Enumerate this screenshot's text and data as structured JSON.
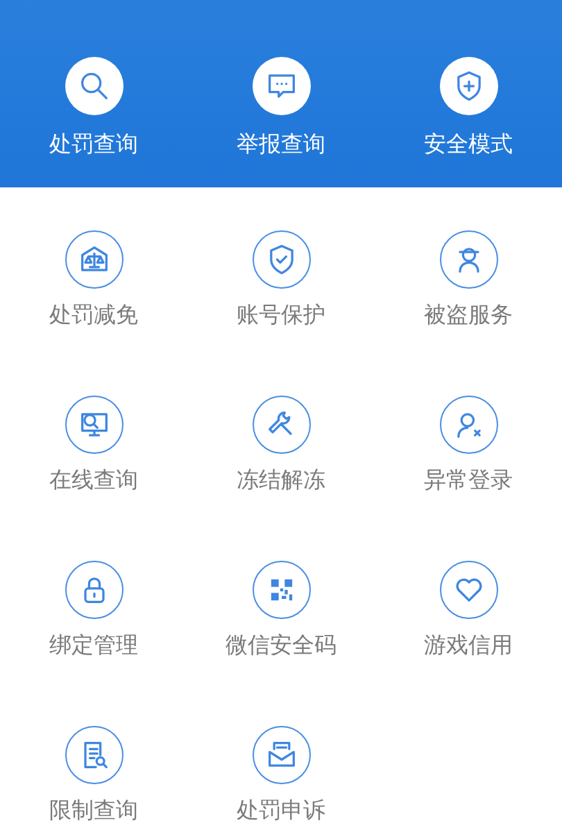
{
  "header_actions": [
    {
      "label": "处罚查询"
    },
    {
      "label": "举报查询"
    },
    {
      "label": "安全模式"
    }
  ],
  "services": [
    {
      "label": "处罚减免"
    },
    {
      "label": "账号保护"
    },
    {
      "label": "被盗服务"
    },
    {
      "label": "在线查询"
    },
    {
      "label": "冻结解冻"
    },
    {
      "label": "异常登录"
    },
    {
      "label": "绑定管理"
    },
    {
      "label": "微信安全码"
    },
    {
      "label": "游戏信用"
    },
    {
      "label": "限制查询"
    },
    {
      "label": "处罚申诉"
    }
  ]
}
